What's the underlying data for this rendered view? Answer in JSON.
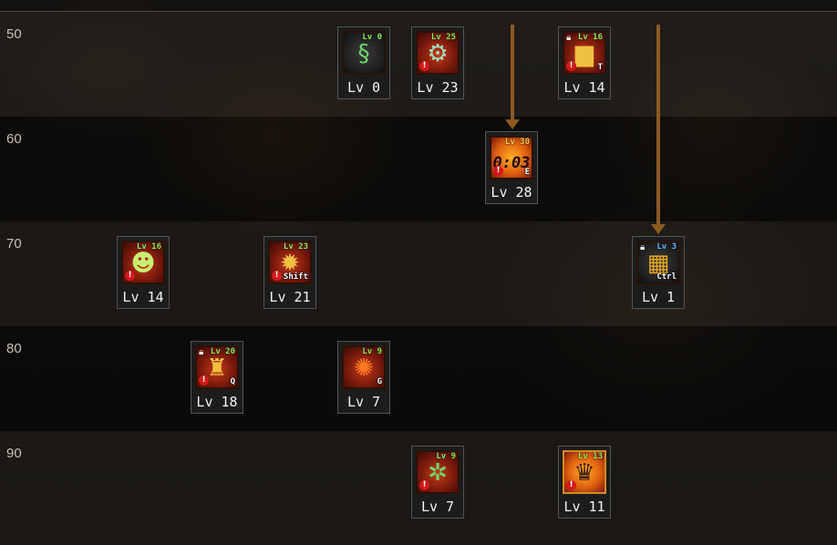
{
  "levels": [
    "50",
    "60",
    "70",
    "80",
    "90"
  ],
  "skills": [
    {
      "icon": "green-swirl-icon",
      "lv": "Lv 0",
      "mini_lv": "Lv 0",
      "locked": false,
      "warn": false,
      "hotkey": ""
    },
    {
      "icon": "gear-target-icon",
      "lv": "Lv 23",
      "mini_lv": "Lv 25",
      "locked": false,
      "warn": true,
      "hotkey": ""
    },
    {
      "icon": "tower-icon",
      "lv": "Lv 14",
      "mini_lv": "Lv 16",
      "locked": true,
      "warn": true,
      "hotkey": "T"
    },
    {
      "icon": "timer-bomb-icon",
      "lv": "Lv 28",
      "mini_lv": "Lv 30",
      "locked": false,
      "warn": true,
      "hotkey": "E",
      "glyph": "0:03"
    },
    {
      "icon": "mask-face-icon",
      "lv": "Lv 14",
      "mini_lv": "Lv 16",
      "locked": false,
      "warn": true,
      "hotkey": ""
    },
    {
      "icon": "swarm-icon",
      "lv": "Lv 21",
      "mini_lv": "Lv 23",
      "locked": false,
      "warn": true,
      "hotkey": "Shift"
    },
    {
      "icon": "robot-laser-icon",
      "lv": "Lv 1",
      "mini_lv": "Lv 3",
      "locked": true,
      "warn": false,
      "hotkey": "Ctrl"
    },
    {
      "icon": "robot-icon",
      "lv": "Lv 18",
      "mini_lv": "Lv 20",
      "locked": true,
      "warn": true,
      "hotkey": "Q"
    },
    {
      "icon": "flame-orb-icon",
      "lv": "Lv 7",
      "mini_lv": "Lv 9",
      "locked": false,
      "warn": false,
      "hotkey": "G"
    },
    {
      "icon": "bug-drone-icon",
      "lv": "Lv 7",
      "mini_lv": "Lv 9",
      "locked": false,
      "warn": true,
      "hotkey": ""
    },
    {
      "icon": "pharaoh-bot-icon",
      "lv": "Lv 11",
      "mini_lv": "Lv 13",
      "locked": false,
      "warn": true,
      "hotkey": ""
    }
  ]
}
